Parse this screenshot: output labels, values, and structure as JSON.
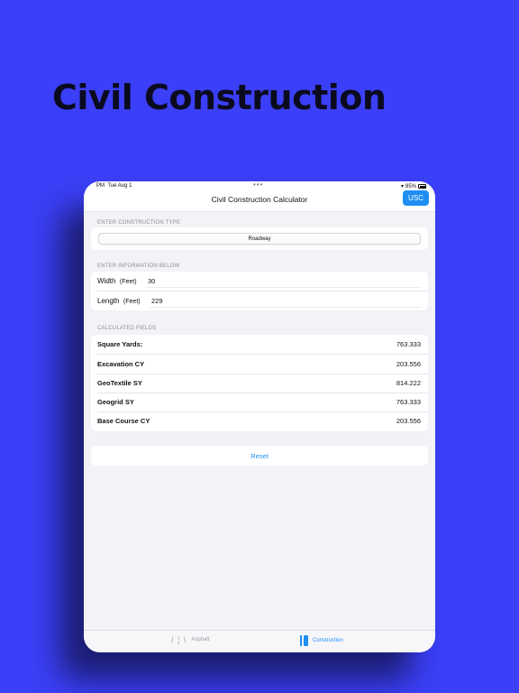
{
  "hero": {
    "title": "Civil Construction"
  },
  "status_bar": {
    "time": "PM",
    "date": "Tue Aug 1",
    "dots": "•••",
    "battery": "85%"
  },
  "nav": {
    "title": "Civil Construction Calculator",
    "unit_button": "USC"
  },
  "construction_type": {
    "header": "ENTER CONSTRUCTION TYPE",
    "selected": "Roadway"
  },
  "information": {
    "header": "ENTER INFORMATION BELOW",
    "fields": [
      {
        "label": "Width",
        "unit": "(Feet)",
        "value": "30"
      },
      {
        "label": "Length",
        "unit": "(Feet)",
        "value": "229"
      }
    ]
  },
  "calculated": {
    "header": "CALCULATED FIELDS",
    "rows": [
      {
        "label": "Square Yards:",
        "value": "763.333"
      },
      {
        "label": "Excavation  CY",
        "value": "203.556"
      },
      {
        "label": "GeoTextile  SY",
        "value": "814.222"
      },
      {
        "label": "Geogrid  SY",
        "value": "763.333"
      },
      {
        "label": "Base Course  CY",
        "value": "203.556"
      }
    ]
  },
  "reset": {
    "label": "Reset"
  },
  "tabs": [
    {
      "label": "Asphalt",
      "icon": "road-icon",
      "active": false
    },
    {
      "label": "Construction",
      "icon": "construction-icon",
      "active": true
    }
  ],
  "colors": {
    "background": "#3b3ff7",
    "accent": "#1f8ef3",
    "hero_text": "#0b0b20"
  }
}
